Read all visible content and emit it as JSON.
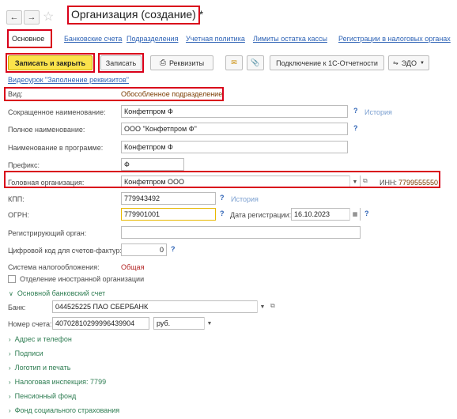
{
  "header": {
    "title": "Организация (создание) *"
  },
  "tabs": [
    {
      "label": "Основное"
    },
    {
      "label": "Банковские счета"
    },
    {
      "label": "Подразделения"
    },
    {
      "label": "Учетная политика"
    },
    {
      "label": "Лимиты остатка кассы"
    },
    {
      "label": "Регистрации в налоговых органах"
    }
  ],
  "toolbar": {
    "save_close": "Записать и закрыть",
    "save": "Записать",
    "requisites": "Реквизиты",
    "connect": "Подключение к 1С-Отчетности",
    "edo": "ЭДО"
  },
  "video_link": "Видеоурок \"Заполнение реквизитов\"",
  "form": {
    "vid_label": "Вид:",
    "vid_value": "Обособленное подразделение",
    "short_name_label": "Сокращенное наименование:",
    "short_name_value": "Конфетпром Ф",
    "full_name_label": "Полное наименование:",
    "full_name_value": "ООО \"Конфетпром Ф\"",
    "program_name_label": "Наименование в программе:",
    "program_name_value": "Конфетпром Ф",
    "prefix_label": "Префикс:",
    "prefix_value": "Ф",
    "head_org_label": "Головная организация:",
    "head_org_value": "Конфетпром ООО",
    "inn_label": "ИНН:",
    "inn_value": "7799555550",
    "kpp_label": "КПП:",
    "kpp_value": "779943492",
    "ogrn_label": "ОГРН:",
    "ogrn_value": "779901001",
    "reg_date_label": "Дата регистрации:",
    "reg_date_value": "16.10.2023",
    "reg_organ_label": "Регистрирующий орган:",
    "reg_organ_value": "",
    "digital_code_label": "Цифровой код для счетов-фактур:",
    "digital_code_value": "0",
    "tax_system_label": "Система налогообложения:",
    "tax_system_value": "Общая",
    "foreign_org_label": "Отделение иностранной организации",
    "history": "История",
    "question": "?"
  },
  "bank": {
    "section_label": "Основной банковский счет",
    "bank_label": "Банк:",
    "bank_value": "044525225 ПАО СБЕРБАНК",
    "account_label": "Номер счета:",
    "account_value": "40702810299996439904",
    "currency_value": "руб."
  },
  "sections": [
    {
      "label": "Адрес и телефон"
    },
    {
      "label": "Подписи"
    },
    {
      "label": "Логотип и печать"
    },
    {
      "label": "Налоговая инспекция: 7799"
    },
    {
      "label": "Пенсионный фонд"
    },
    {
      "label": "Фонд социального страхования"
    }
  ],
  "colors": {
    "highlight": "#d9001a",
    "link": "#2e63b6",
    "section": "#2e7d52",
    "primary_button": "#fbe34b",
    "value_red": "#b22222"
  },
  "icons": [
    "back-arrow-icon",
    "forward-arrow-icon",
    "star-icon",
    "printer-icon",
    "mail-icon",
    "paperclip-icon",
    "edo-icon",
    "chevron-down-icon",
    "chevron-right-icon",
    "calendar-icon",
    "open-icon"
  ]
}
